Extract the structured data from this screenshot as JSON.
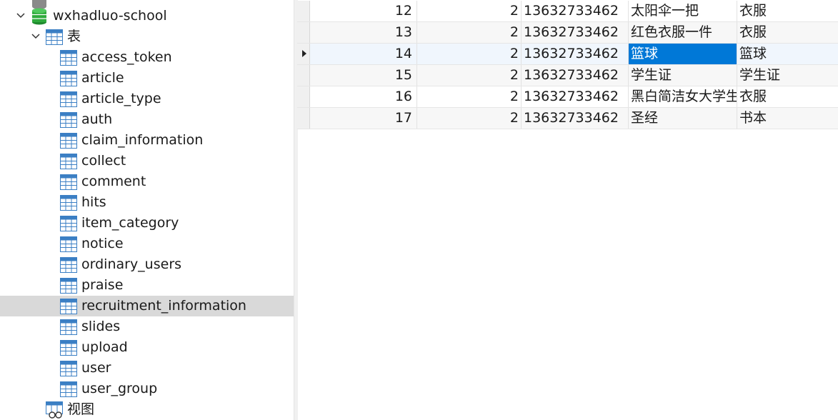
{
  "tree": {
    "database": "wxhadluo-school",
    "tables_group": "表",
    "views_group": "视图",
    "tables": [
      "access_token",
      "article",
      "article_type",
      "auth",
      "claim_information",
      "collect",
      "comment",
      "hits",
      "item_category",
      "notice",
      "ordinary_users",
      "praise",
      "recruitment_information",
      "slides",
      "upload",
      "user",
      "user_group"
    ],
    "selected_table": "recruitment_information"
  },
  "grid": {
    "rows": [
      {
        "id": "12",
        "uid": "2",
        "phone": "13632733462",
        "name": "太阳伞一把",
        "category": "衣服"
      },
      {
        "id": "13",
        "uid": "2",
        "phone": "13632733462",
        "name": "红色衣服一件",
        "category": "衣服"
      },
      {
        "id": "14",
        "uid": "2",
        "phone": "13632733462",
        "name": "篮球",
        "category": "篮球"
      },
      {
        "id": "15",
        "uid": "2",
        "phone": "13632733462",
        "name": "学生证",
        "category": "学生证"
      },
      {
        "id": "16",
        "uid": "2",
        "phone": "13632733462",
        "name": "黑白简洁女大学生",
        "category": "衣服"
      },
      {
        "id": "17",
        "uid": "2",
        "phone": "13632733462",
        "name": "圣经",
        "category": "书本"
      }
    ],
    "current_row": 2
  },
  "colors": {
    "selection": "#0078d7",
    "db_icon": "#2eaa3c",
    "table_icon": "#3b7fc4"
  }
}
